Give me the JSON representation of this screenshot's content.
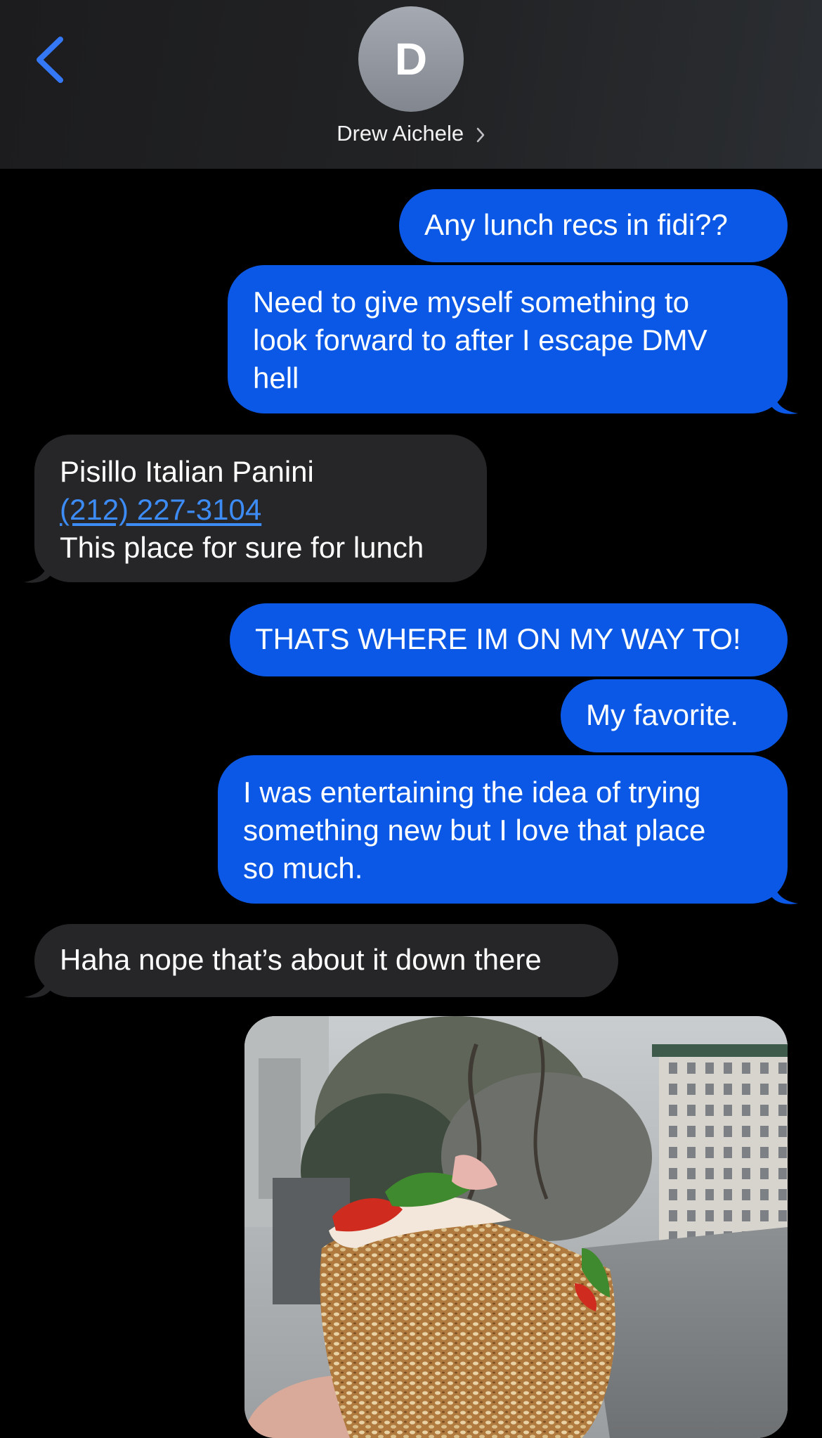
{
  "header": {
    "contact_initial": "D",
    "contact_name": "Drew Aichele"
  },
  "messages": [
    {
      "from": "me",
      "lines": [
        "Any lunch recs in fidi??"
      ]
    },
    {
      "from": "me",
      "lines": [
        "Need to give myself something to",
        "look forward to after I escape DMV",
        "hell"
      ]
    },
    {
      "from": "them",
      "lines": [
        "Pisillo Italian Panini",
        "(212) 227-3104",
        "This place for sure for lunch"
      ]
    },
    {
      "from": "me",
      "lines": [
        "THATS WHERE IM ON MY WAY TO!"
      ]
    },
    {
      "from": "me",
      "lines": [
        "My favorite."
      ]
    },
    {
      "from": "me",
      "lines": [
        "I was entertaining the idea of trying",
        "something new but I love that place",
        "so much."
      ]
    },
    {
      "from": "them",
      "lines": [
        "Haha nope that’s about it down there"
      ]
    }
  ],
  "colors": {
    "outgoing_bubble": "#0a58e5",
    "incoming_bubble": "#262628",
    "link": "#3d8cf5",
    "accent": "#3478f6"
  },
  "icons": {
    "back": "chevron-left-icon",
    "contact_detail": "chevron-right-icon"
  }
}
